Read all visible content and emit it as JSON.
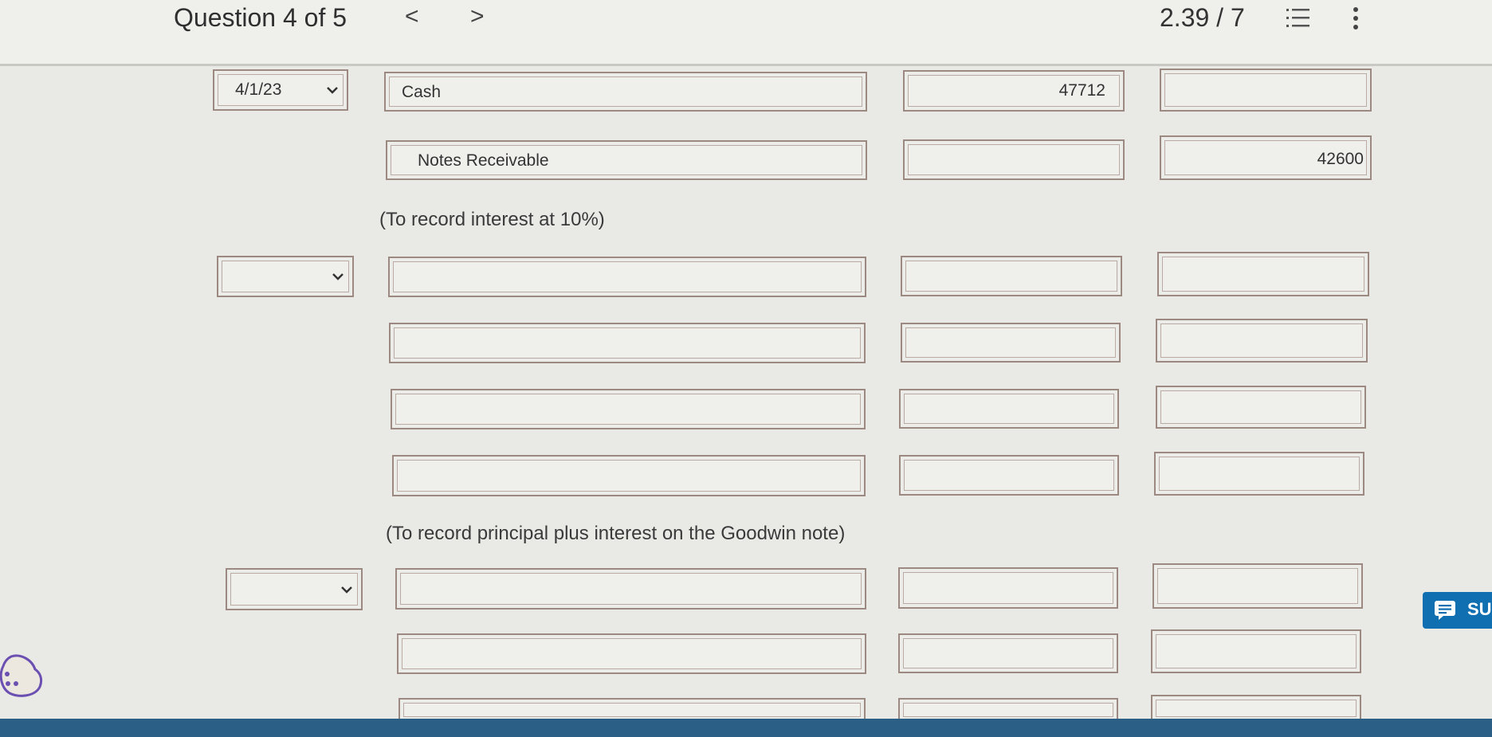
{
  "header": {
    "question_label": "Question 4 of 5",
    "prev_label": "<",
    "next_label": ">",
    "score": "2.39 / 7"
  },
  "entry1": {
    "date": "4/1/23",
    "debit_account": "Cash",
    "debit_amount": "47712",
    "credit_account": "Notes Receivable",
    "credit_amount": "42600",
    "note": "(To record interest at 10%)"
  },
  "entry2": {
    "note": "(To record principal plus interest on the Goodwin note)"
  },
  "side_button": {
    "label": "SU"
  }
}
